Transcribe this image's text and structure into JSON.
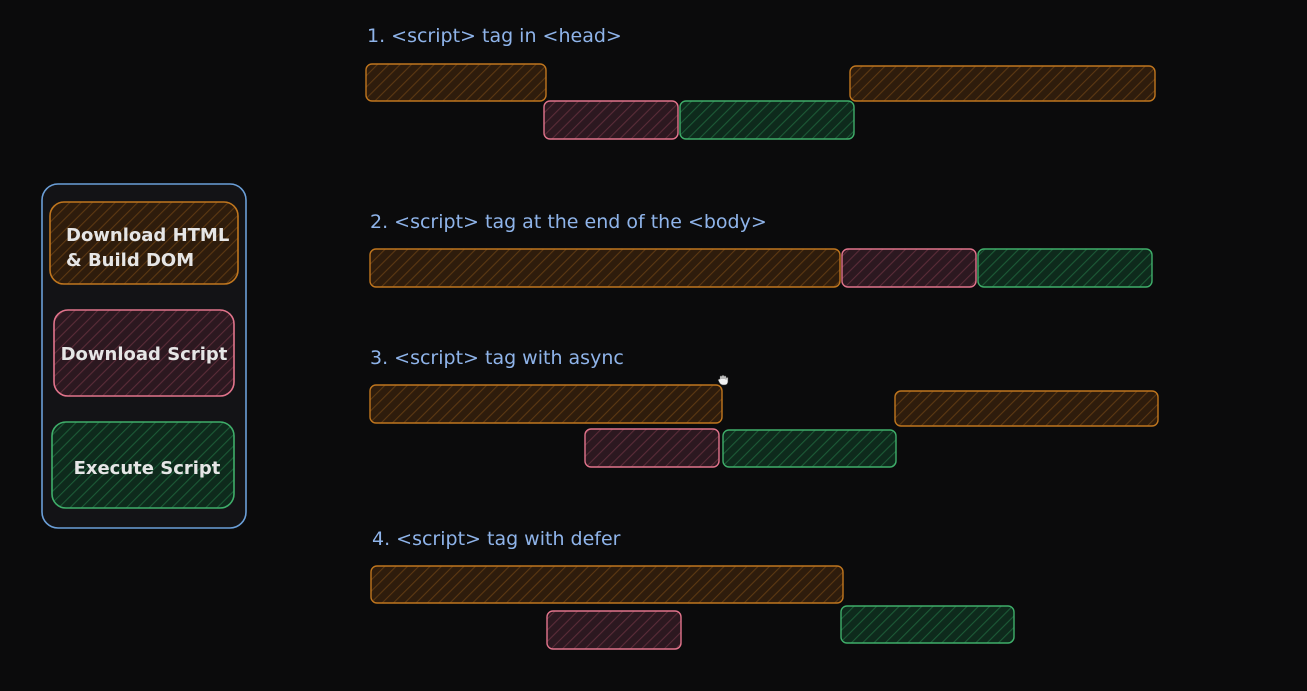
{
  "legend": {
    "items": [
      {
        "key": "html",
        "lines": [
          "Download HTML",
          "& Build DOM"
        ]
      },
      {
        "key": "download",
        "lines": [
          "Download Script"
        ]
      },
      {
        "key": "execute",
        "lines": [
          "Execute Script"
        ]
      }
    ]
  },
  "colors": {
    "background": "#0b0b0c",
    "title": "#8fb4ea",
    "legend_border": "#6b9fd8",
    "html": {
      "stroke": "#c0761e",
      "fill": "#2e1c0c",
      "hatch": "#5c3812"
    },
    "download": {
      "stroke": "#e2748c",
      "fill": "#2c1820",
      "hatch": "#5a2c38"
    },
    "execute": {
      "stroke": "#3fae6a",
      "fill": "#0e2a1c",
      "hatch": "#1c5a36"
    }
  },
  "sections": [
    {
      "title": "1. <script> tag in <head>"
    },
    {
      "title": "2. <script> tag at the end of the <body>"
    },
    {
      "title": "3. <script> tag with async"
    },
    {
      "title": "4. <script> tag with defer"
    }
  ]
}
